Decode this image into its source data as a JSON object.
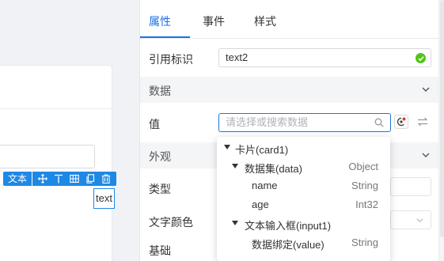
{
  "canvas": {
    "toolbar": {
      "label": "文本",
      "icons": [
        "move-icon",
        "align-top-icon",
        "grid-icon",
        "copy-icon",
        "delete-icon"
      ]
    },
    "text_element": "text"
  },
  "panel": {
    "tabs": [
      {
        "label": "属性",
        "active": true
      },
      {
        "label": "事件",
        "active": false
      },
      {
        "label": "样式",
        "active": false
      }
    ],
    "ref_label": "引用标识",
    "ref_value": "text2",
    "data_section": "数据",
    "value_label": "值",
    "value_placeholder": "请选择或搜索数据",
    "appearance_section": "外观",
    "type_label": "类型",
    "text_color_label": "文字颜色",
    "base_label": "基础"
  },
  "dropdown": {
    "nodes": [
      {
        "label": "卡片(card1)",
        "type": "",
        "expanded": true
      },
      {
        "label": "数据集(data)",
        "type": "Object",
        "expanded": true
      },
      {
        "label": "name",
        "type": "String"
      },
      {
        "label": "age",
        "type": "Int32"
      },
      {
        "label": "文本输入框(input1)",
        "type": "",
        "expanded": true
      },
      {
        "label": "数据绑定(value)",
        "type": "String"
      }
    ]
  },
  "colors": {
    "accent": "#1a73e8",
    "toolbar": "#1e88e5",
    "valid": "#52c41a"
  }
}
